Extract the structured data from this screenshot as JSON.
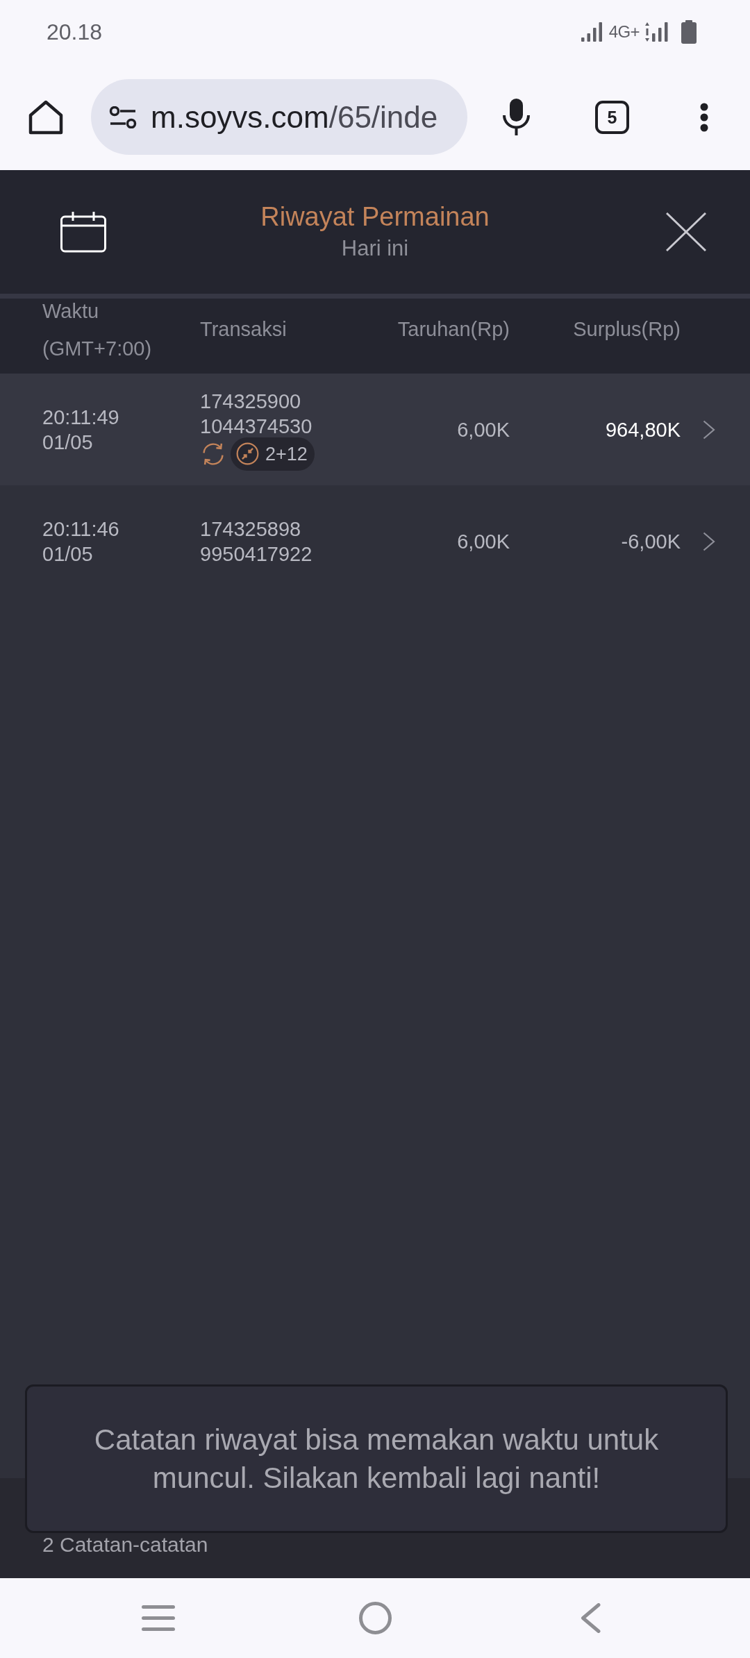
{
  "status_bar": {
    "time": "20.18",
    "network": "4G+"
  },
  "browser": {
    "url_host": "m.soyvs.com",
    "url_path": "/65/inde",
    "tab_count": "5"
  },
  "header": {
    "title": "Riwayat Permainan",
    "subtitle": "Hari ini"
  },
  "table": {
    "columns": [
      {
        "label": "Waktu",
        "sublabel": "(GMT+7:00)"
      },
      {
        "label": "Transaksi"
      },
      {
        "label": "Taruhan(Rp)"
      },
      {
        "label": "Surplus(Rp)"
      }
    ],
    "rows": [
      {
        "time": "20:11:49",
        "date": "01/05",
        "transaction": [
          "174325900",
          "1044374530"
        ],
        "tags": [
          {
            "kind": "respin"
          },
          {
            "kind": "feature",
            "label": "2+12"
          }
        ],
        "bet": "6,00K",
        "surplus": "964,80K",
        "win": true
      },
      {
        "time": "20:11:46",
        "date": "01/05",
        "transaction": [
          "174325898",
          "9950417922"
        ],
        "bet": "6,00K",
        "surplus": "-6,00K",
        "win": false
      }
    ]
  },
  "footer": {
    "count": "2 Catatan-catatan"
  },
  "toast": {
    "message": "Catatan riwayat bisa memakan waktu untuk muncul. Silakan kembali lagi nanti!"
  }
}
